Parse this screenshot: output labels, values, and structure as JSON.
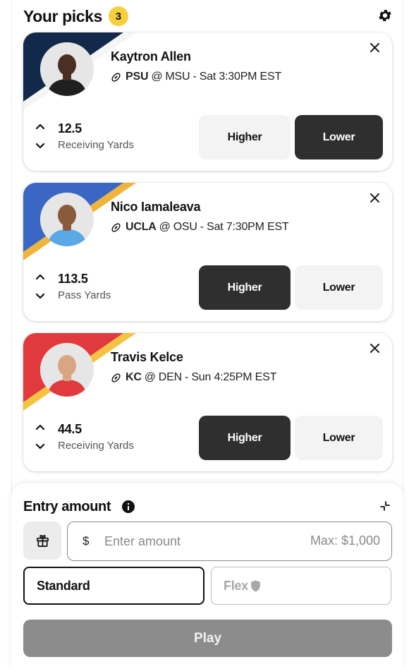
{
  "header": {
    "title": "Your picks",
    "count": "3",
    "settings_icon": "gear-icon"
  },
  "picks": [
    {
      "player": "Kaytron Allen",
      "team": "PSU",
      "opponent": "MSU",
      "time": "- Sat 3:30PM EST",
      "line": "12.5",
      "stat": "Receiving Yards",
      "selected": "lower",
      "colors": {
        "primary": "#13294b",
        "secondary": "#f5f5f5",
        "jersey": "#1f1f1f",
        "skin": "#4a2f22"
      }
    },
    {
      "player": "Nico Iamaleava",
      "team": "UCLA",
      "opponent": "OSU",
      "time": "- Sat 7:30PM EST",
      "line": "113.5",
      "stat": "Pass Yards",
      "selected": "higher",
      "colors": {
        "primary": "#3b67c4",
        "secondary": "#f0b43a",
        "jersey": "#5aa9e6",
        "skin": "#8a5a3d"
      }
    },
    {
      "player": "Travis Kelce",
      "team": "KC",
      "opponent": "DEN",
      "time": "- Sun 4:25PM EST",
      "line": "44.5",
      "stat": "Receiving Yards",
      "selected": "higher",
      "colors": {
        "primary": "#e03a3e",
        "secondary": "#f5c242",
        "jersey": "#e03a3e",
        "skin": "#d9a684"
      }
    }
  ],
  "labels": {
    "at": "@",
    "higher": "Higher",
    "lower": "Lower"
  },
  "entry": {
    "title": "Entry amount",
    "currency": "$",
    "placeholder": "Enter amount",
    "max": "Max: $1,000",
    "standard": "Standard",
    "flex": "Flex",
    "play": "Play"
  }
}
